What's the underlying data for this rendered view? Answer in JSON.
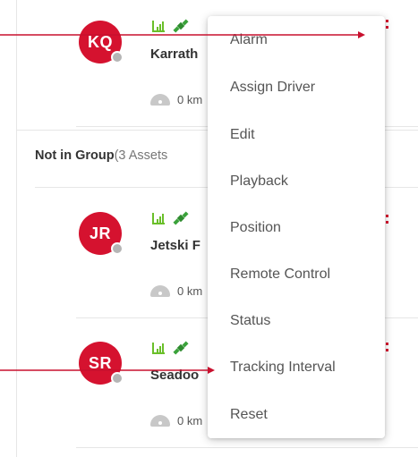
{
  "assets": [
    {
      "initials": "KQ",
      "name": "Karrath",
      "speed": "0 km"
    },
    {
      "initials": "JR",
      "name": "Jetski F",
      "speed": "0 km"
    },
    {
      "initials": "SR",
      "name": "Seadoo",
      "speed": "0 km"
    }
  ],
  "group": {
    "name": "Not in Group",
    "count": "(3 Assets"
  },
  "menu": {
    "items": [
      "Alarm",
      "Assign Driver",
      "Edit",
      "Playback",
      "Position",
      "Remote Control",
      "Status",
      "Tracking Interval",
      "Reset"
    ]
  },
  "colors": {
    "accent": "#d5122f",
    "signal": "#6abf2a",
    "status_dot": "#b5b5b5"
  },
  "icons": {
    "signal": "signal-bars-icon",
    "gps": "satellite-icon",
    "gauge": "speedometer-icon"
  }
}
